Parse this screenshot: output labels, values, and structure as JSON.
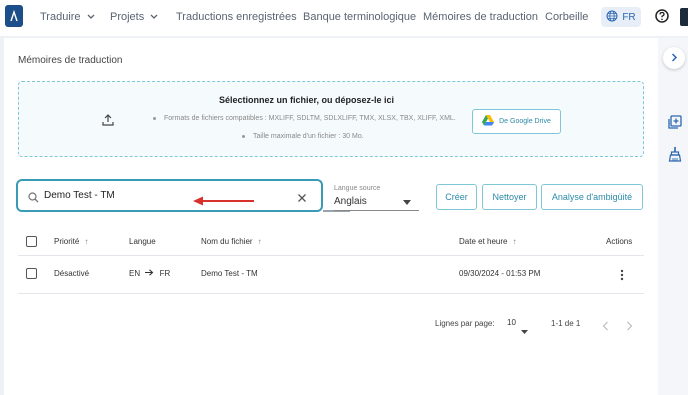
{
  "nav": {
    "translate": "Traduire",
    "projects": "Projets",
    "saved_translations": "Traductions enregistrées",
    "term_bank": "Banque terminologique",
    "translation_memories": "Mémoires de traduction",
    "trash": "Corbeille",
    "language": "FR"
  },
  "page": {
    "title": "Mémoires de traduction"
  },
  "dropzone": {
    "title": "Sélectionnez un fichier, ou déposez-le ici",
    "formats": "Formats de fichiers compatibles : MXLIFF, SDLTM, SDLXLIFF, TMX, XLSX, TBX, XLIFF, XML.",
    "max_size": "Taille maximale d'un fichier : 30 Mo.",
    "gdrive_label": "De Google Drive"
  },
  "search": {
    "value": "Demo Test - TM"
  },
  "source_lang": {
    "label": "Langue source",
    "value": "Anglais"
  },
  "actions": {
    "create": "Créer",
    "clean": "Nettoyer",
    "ambiguity": "Analyse d'ambigüité"
  },
  "table": {
    "headers": {
      "priority": "Priorité",
      "language": "Langue",
      "filename": "Nom du fichier",
      "datetime": "Date et heure",
      "actions": "Actions"
    },
    "rows": [
      {
        "priority": "Désactivé",
        "source": "EN",
        "target": "FR",
        "filename": "Demo Test - TM",
        "datetime": "09/30/2024 - 01:53 PM"
      }
    ]
  },
  "pagination": {
    "rows_per_page_label": "Lignes par page:",
    "rows_per_page": "10",
    "range": "1-1 de 1"
  },
  "colors": {
    "accent": "#3a9bb5",
    "annotation_arrow": "#d8312b"
  },
  "icons": [
    "logo-icon",
    "chevron-down-icon",
    "globe-icon",
    "help-icon",
    "upload-icon",
    "google-drive-icon",
    "search-icon",
    "close-icon",
    "arrow-up-icon",
    "arrow-right-icon",
    "more-vert-icon",
    "chevron-left-icon",
    "chevron-right-icon",
    "add-box-icon",
    "cleaning-brush-icon"
  ]
}
